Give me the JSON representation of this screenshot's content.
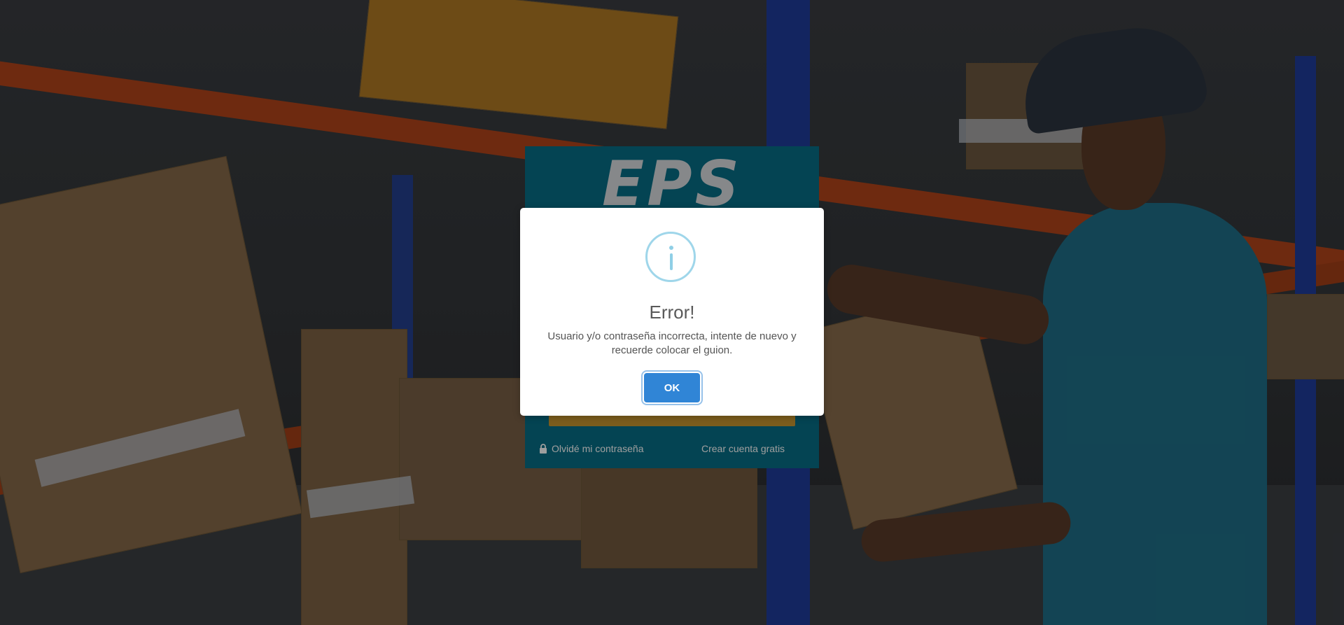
{
  "login": {
    "logo_text": "EPS",
    "forgot_password_label": "Olvidé mi contraseña",
    "create_account_label": "Crear cuenta gratis"
  },
  "icons": {
    "modal": "info-icon",
    "forgot": "lock-icon"
  },
  "modal": {
    "title": "Error!",
    "message": "Usuario y/o contraseña incorrecta, intente de nuevo y recuerde colocar el guion.",
    "ok_label": "OK"
  },
  "colors": {
    "login_panel": "#086f86",
    "confirm_button": "#3085d6",
    "info_icon": "#9fd6ea",
    "submit_strip": "#c9962f"
  }
}
